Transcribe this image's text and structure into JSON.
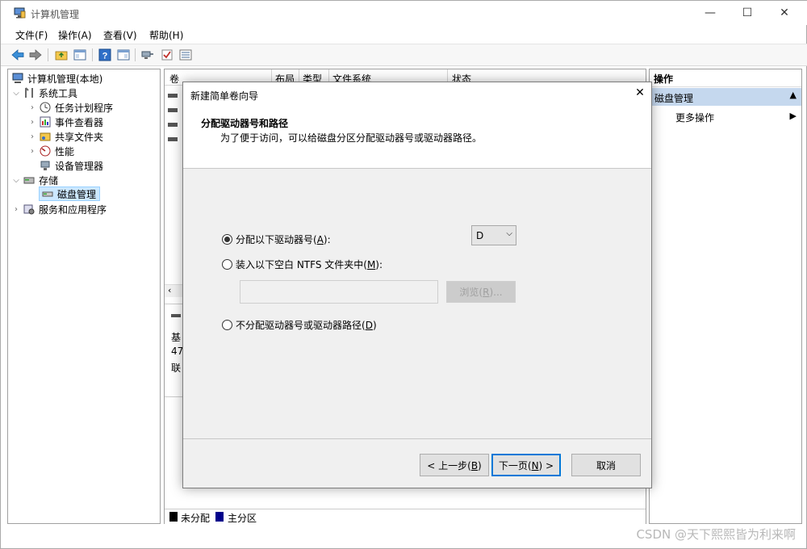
{
  "window": {
    "title": "计算机管理",
    "controls": {
      "minimize": "—",
      "maximize": "☐",
      "close": "✕"
    }
  },
  "menubar": {
    "items": [
      "文件(F)",
      "操作(A)",
      "查看(V)",
      "帮助(H)"
    ]
  },
  "toolbar": {
    "icons": [
      "back-arrow-icon",
      "forward-arrow-icon",
      "up-folder-icon",
      "show-hide-tree-icon",
      "help-icon",
      "properties-icon",
      "connect-icon",
      "check-icon",
      "list-icon"
    ]
  },
  "tree": {
    "root": "计算机管理(本地)",
    "system_tools": "系统工具",
    "task_scheduler": "任务计划程序",
    "event_viewer": "事件查看器",
    "shared_folders": "共享文件夹",
    "performance": "性能",
    "device_manager": "设备管理器",
    "storage": "存储",
    "disk_management": "磁盘管理",
    "services_apps": "服务和应用程序"
  },
  "center": {
    "columns": [
      "卷",
      "布局",
      "类型",
      "文件系统",
      "状态"
    ],
    "disk_info": [
      "基",
      "47",
      "联"
    ],
    "legend": {
      "unallocated": "未分配",
      "primary": "主分区",
      "unallocated_color": "#000000",
      "primary_color": "#00008b"
    }
  },
  "actions": {
    "header": "操作",
    "section": "磁盘管理",
    "more": "更多操作"
  },
  "dialog": {
    "title": "新建简单卷向导",
    "heading": "分配驱动器号和路径",
    "subheading": "为了便于访问，可以给磁盘分区分配驱动器号或驱动器路径。",
    "option_assign": {
      "prefix": "分配以下驱动器号(",
      "key": "A",
      "suffix": "):",
      "selected": true
    },
    "drive_letter": "D",
    "option_mount": {
      "prefix": "装入以下空白 NTFS 文件夹中(",
      "key": "M",
      "suffix": "):",
      "selected": false
    },
    "folder_path": "",
    "browse": {
      "prefix": "浏览(",
      "key": "R",
      "suffix": ")..."
    },
    "option_none": {
      "prefix": "不分配驱动器号或驱动器路径(",
      "key": "D",
      "suffix": ")",
      "selected": false
    },
    "back": {
      "prefix": "< 上一步(",
      "key": "B",
      "suffix": ")"
    },
    "next": {
      "prefix": "下一页(",
      "key": "N",
      "suffix": ") >"
    },
    "cancel": "取消"
  },
  "watermark": "CSDN @天下熙熙皆为利来啊"
}
